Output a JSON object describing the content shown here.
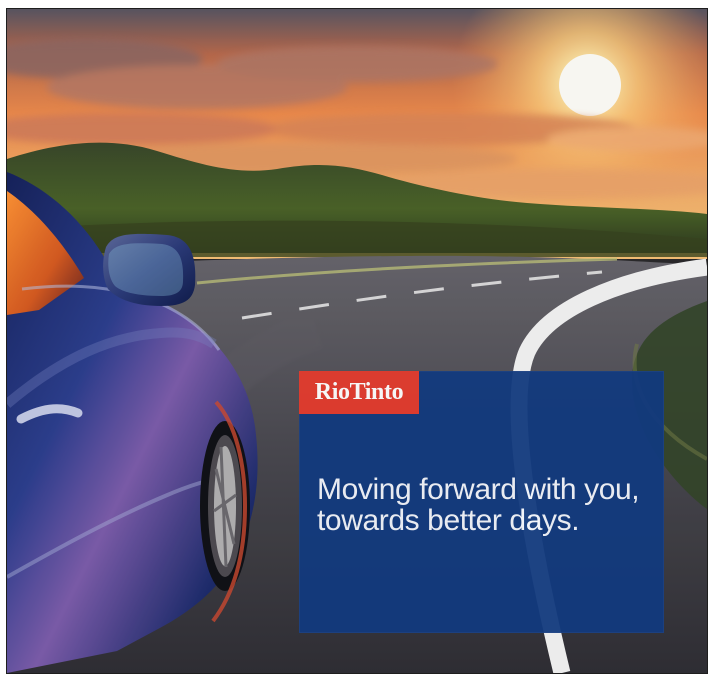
{
  "ad": {
    "brand": "RioTinto",
    "tagline_lines": [
      "Moving forward with you,",
      "towards better days."
    ]
  },
  "colors": {
    "brand_red": "#e33b2d",
    "panel_blue": "#123a7e",
    "text": "#f2f5fb"
  },
  "scene": {
    "subject": "car-on-road-at-sunset"
  }
}
